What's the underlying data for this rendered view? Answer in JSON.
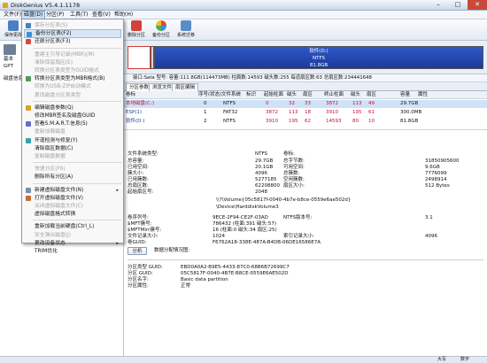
{
  "window": {
    "title": "DiskGenius V5.4.1.1178",
    "minimize": "–",
    "maximize": "□",
    "close": "✕"
  },
  "menubar": {
    "items": [
      {
        "label": "文件(F)",
        "active": false
      },
      {
        "label": "磁盘(D)",
        "active": true
      },
      {
        "label": "分区(P)",
        "active": false
      },
      {
        "label": "工具(T)",
        "active": false
      },
      {
        "label": "查看(V)",
        "active": false
      },
      {
        "label": "帮助(H)",
        "active": false
      }
    ]
  },
  "toolbar": {
    "save_label": "保存更改",
    "backup_label": "分区备份",
    "delete_label": "删除分区",
    "backup_part_label": "备份分区",
    "migrate_label": "系统迁移"
  },
  "left_panel": {
    "label1": "基本",
    "label2": "GPT",
    "disk_label": "磁盘信息"
  },
  "disk_menu": [
    {
      "label": "保存分区表(S)",
      "enabled": false,
      "icon": "save-icon",
      "has_submenu": false
    },
    {
      "label": "备份分区表(F2)",
      "enabled": true,
      "icon": "backup-table-icon",
      "has_submenu": false
    },
    {
      "label": "还原分区表(F3)",
      "enabled": true,
      "icon": "restore-table-icon",
      "has_submenu": false
    },
    {
      "sep": true
    },
    {
      "label": "重建主引导记录(MBR)(M)",
      "enabled": false,
      "icon": "",
      "has_submenu": false
    },
    {
      "label": "清除保留扇区(E)",
      "enabled": false,
      "icon": "",
      "has_submenu": false
    },
    {
      "label": "转换分区表类型为GUID格式",
      "enabled": false,
      "icon": "",
      "has_submenu": false
    },
    {
      "label": "转换分区表类型为MBR格式(B)",
      "enabled": true,
      "icon": "convert-icon",
      "has_submenu": false
    },
    {
      "label": "转换为USB-ZIP启动模式",
      "enabled": false,
      "icon": "",
      "has_submenu": false
    },
    {
      "label": "更改磁盘分区表类型",
      "enabled": false,
      "icon": "",
      "has_submenu": false
    },
    {
      "sep": true
    },
    {
      "label": "编辑磁盘参数(Q)",
      "enabled": true,
      "icon": "edit-params-icon",
      "has_submenu": false
    },
    {
      "label": "修改MBR签名及磁盘GUID",
      "enabled": true,
      "icon": "",
      "has_submenu": false
    },
    {
      "label": "查看S.M.A.R.T.信息(S)",
      "enabled": true,
      "icon": "smart-icon",
      "has_submenu": false
    },
    {
      "label": "重新加载磁盘",
      "enabled": false,
      "icon": "",
      "has_submenu": false
    },
    {
      "label": "坏道检测与修复(Y)",
      "enabled": true,
      "icon": "scan-icon",
      "has_submenu": false
    },
    {
      "label": "清除扇区数据(C)",
      "enabled": true,
      "icon": "",
      "has_submenu": false
    },
    {
      "label": "复制磁盘数据",
      "enabled": false,
      "icon": "",
      "has_submenu": false
    },
    {
      "sep": true
    },
    {
      "label": "快速分区(F6)",
      "enabled": false,
      "icon": "",
      "has_submenu": false
    },
    {
      "label": "删除所有分区(A)",
      "enabled": true,
      "icon": "",
      "has_submenu": false
    },
    {
      "sep": true
    },
    {
      "label": "新建虚拟磁盘文件(N)",
      "enabled": true,
      "icon": "new-vdisk-icon",
      "has_submenu": true
    },
    {
      "label": "打开虚拟磁盘文件(V)",
      "enabled": true,
      "icon": "open-vdisk-icon",
      "has_submenu": false
    },
    {
      "label": "关闭虚拟磁盘文件(C)",
      "enabled": false,
      "icon": "",
      "has_submenu": false
    },
    {
      "label": "虚拟磁盘格式转换",
      "enabled": true,
      "icon": "",
      "has_submenu": false
    },
    {
      "sep": true
    },
    {
      "label": "重新加载当前硬盘(Ctrl_L)",
      "enabled": true,
      "icon": "",
      "has_submenu": false
    },
    {
      "label": "安全弹出磁盘(J)",
      "enabled": false,
      "icon": "",
      "has_submenu": false
    },
    {
      "label": "更改设备状态",
      "enabled": true,
      "icon": "",
      "has_submenu": true
    },
    {
      "label": "TRIM优化",
      "enabled": true,
      "icon": "",
      "has_submenu": false
    }
  ],
  "disk_bar": {
    "partition_name": "软件(D:)",
    "fs": "NTFS",
    "size": "81.8GB"
  },
  "disk_info": "接口:Sata  型号:  容量:111.8GB(114473MB)  柱面数:14593  磁头数:255  每道扇区数:63  总扇区数:234441648",
  "tabs": [
    "分区参数",
    "浏览文件",
    "扇区编辑"
  ],
  "table_headers": [
    "卷标",
    "序号(状态)",
    "文件系统",
    "标识",
    "起始柱面",
    "磁头",
    "扇区",
    "终止柱面",
    "磁头",
    "扇区",
    "容量",
    "属性"
  ],
  "partitions": [
    {
      "name": "本地磁盘(C:)",
      "idx": "0",
      "fs": "NTFS",
      "id": "",
      "sc": "0",
      "sh": "32",
      "ss": "33",
      "ec": "3872",
      "eh": "113",
      "es": "49",
      "cap": "29.7GB",
      "attr": ""
    },
    {
      "name": "ESP(1)",
      "idx": "1",
      "fs": "FAT32",
      "id": "",
      "sc": "3872",
      "sh": "113",
      "ss": "18",
      "ec": "3910",
      "eh": "195",
      "es": "61",
      "cap": "300.0MB",
      "attr": ""
    },
    {
      "name": "软件(D:)",
      "idx": "2",
      "fs": "NTFS",
      "id": "",
      "sc": "3910",
      "sh": "195",
      "ss": "62",
      "ec": "14593",
      "eh": "80",
      "es": "10",
      "cap": "81.8GB",
      "attr": ""
    }
  ],
  "details": {
    "fs_type_label": "文件系统类型:",
    "fs_type": "NTFS",
    "vol_label_label": "卷标:",
    "left_rows": [
      {
        "k": "总容量:",
        "v": "29.7GB"
      },
      {
        "k": "已用空间:",
        "v": "20.1GB"
      },
      {
        "k": "簇大小:",
        "v": "4096"
      },
      {
        "k": "已用簇数:",
        "v": "5277185"
      },
      {
        "k": "总扇区数:",
        "v": "62208800"
      },
      {
        "k": "起始扇区号:",
        "v": "2048"
      }
    ],
    "right_rows": [
      {
        "k": "总字节数:",
        "v": "31850905600"
      },
      {
        "k": "可用空间:",
        "v": "9.6GB"
      },
      {
        "k": "总簇数:",
        "v": "7776099"
      },
      {
        "k": "空闲簇数:",
        "v": "2498914"
      },
      {
        "k": "扇区大小:",
        "v": "512 Bytes"
      }
    ],
    "vol_path": "\\\\?\\Volume{05c5817f-0040-4b7e-b8ce-0559e6ae502d}",
    "dev_path": "\\Device\\HarddiskVolume3",
    "ntfs_rows": [
      {
        "k": "卷序列号:",
        "v": "9ECE-2F94-CE2F-03AD",
        "k2": "NTFS版本号:",
        "v2": "3.1"
      },
      {
        "k": "$MFT簇号:",
        "v": "786432 (柱面:391 磁头:57)",
        "k2": "",
        "v2": ""
      },
      {
        "k": "$MFTMirr簇号:",
        "v": "16 (柱面:0 磁头:34 扇区:25)",
        "k2": "",
        "v2": ""
      },
      {
        "k": "文件记录大小:",
        "v": "1024",
        "k2": "索引记录大小:",
        "v2": "4096"
      },
      {
        "k": "卷GUID:",
        "v": "F6762A18-338E-487A-B4DB-06DE16586E7A",
        "k2": "",
        "v2": ""
      }
    ],
    "analyze_btn": "分析",
    "cluster_label": "数据分配情况图:",
    "guid_rows": [
      {
        "k": "分区类型 GUID:",
        "v": "EBD0A0A2-B9E5-4433-87C0-68B6B72699C7"
      },
      {
        "k": "分区 GUID:",
        "v": "05C5817F-0040-4B7E-B8CE-0559E6AE502D"
      },
      {
        "k": "分区名字:",
        "v": "Basic data partition"
      },
      {
        "k": "分区属性:",
        "v": "正常"
      }
    ]
  },
  "status": {
    "caps": "大写",
    "num": "数字"
  }
}
